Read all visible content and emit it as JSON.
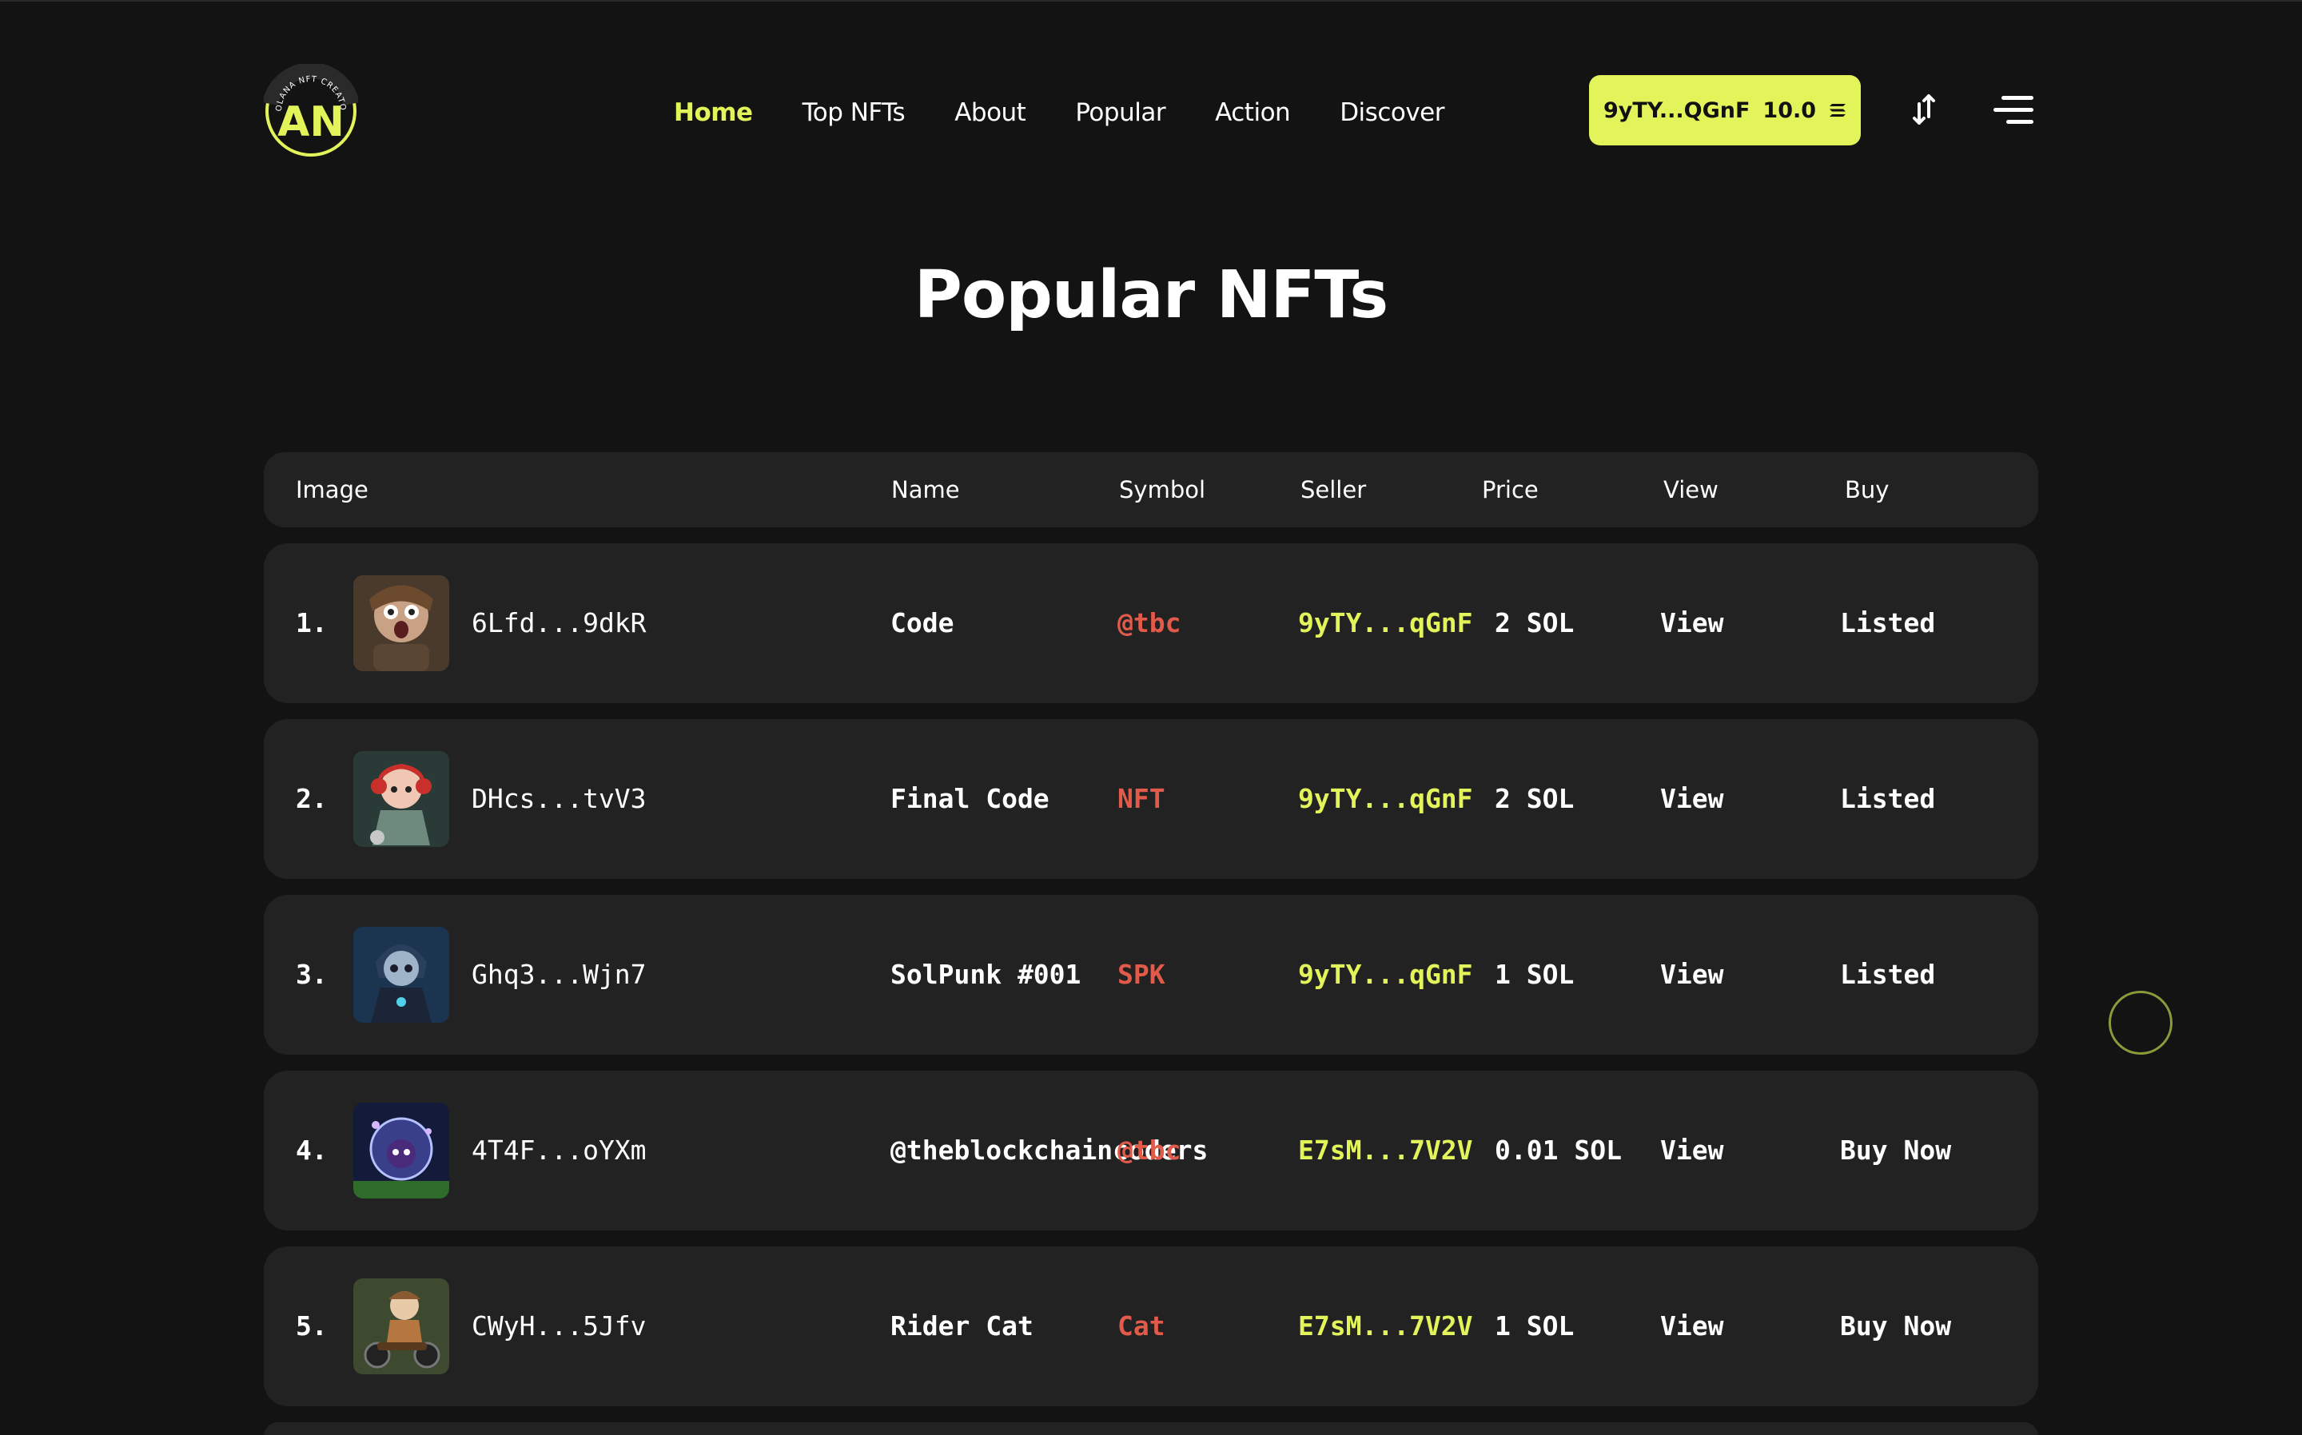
{
  "nav": {
    "items": [
      {
        "label": "Home",
        "active": true
      },
      {
        "label": "Top NFTs",
        "active": false
      },
      {
        "label": "About",
        "active": false
      },
      {
        "label": "Popular",
        "active": false
      },
      {
        "label": "Action",
        "active": false
      },
      {
        "label": "Discover",
        "active": false
      }
    ]
  },
  "logo": {
    "ring_text": "SOLANA NFT CREATOR",
    "mark": "AN",
    "icon": "logo-icon"
  },
  "wallet": {
    "address": "9yTY...QGnF",
    "balance": "10.0",
    "currency_icon": "solana-icon"
  },
  "icons": {
    "sort": "sort-icon",
    "menu": "hamburger-menu-icon"
  },
  "page_title": "Popular NFTs",
  "table": {
    "headers": {
      "image": "Image",
      "name": "Name",
      "symbol": "Symbol",
      "seller": "Seller",
      "price": "Price",
      "view": "View",
      "buy": "Buy"
    },
    "rows": [
      {
        "index": "1.",
        "mint": "6Lfd...9dkR",
        "name": "Code",
        "symbol": "@tbc",
        "seller": "9yTY...qGnF",
        "price": "2 SOL",
        "view": "View",
        "buy": "Listed"
      },
      {
        "index": "2.",
        "mint": "DHcs...tvV3",
        "name": "Final Code",
        "symbol": "NFT",
        "seller": "9yTY...qGnF",
        "price": "2 SOL",
        "view": "View",
        "buy": "Listed"
      },
      {
        "index": "3.",
        "mint": "Ghq3...Wjn7",
        "name": "SolPunk #001",
        "symbol": "SPK",
        "seller": "9yTY...qGnF",
        "price": "1 SOL",
        "view": "View",
        "buy": "Listed"
      },
      {
        "index": "4.",
        "mint": "4T4F...oYXm",
        "name": "@theblockchaincoders",
        "symbol": "@tbc",
        "seller": "E7sM...7V2V",
        "price": "0.01 SOL",
        "view": "View",
        "buy": "Buy Now"
      },
      {
        "index": "5.",
        "mint": "CWyH...5Jfv",
        "name": "Rider Cat",
        "symbol": "Cat",
        "seller": "E7sM...7V2V",
        "price": "1 SOL",
        "view": "View",
        "buy": "Buy Now"
      }
    ]
  },
  "colors": {
    "accent": "#e3f35a",
    "symbol": "#e25a4a",
    "background": "#131313",
    "card": "#222222"
  }
}
